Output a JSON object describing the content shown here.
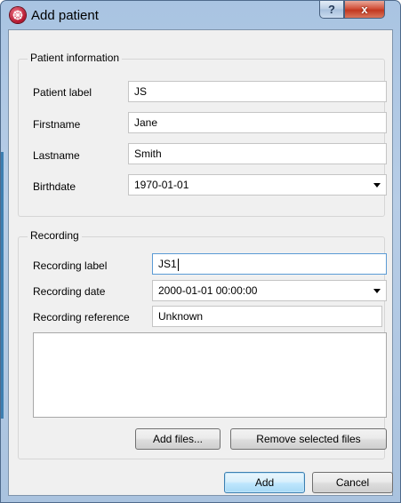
{
  "window": {
    "title": "Add patient",
    "help_glyph": "?",
    "close_glyph": "x",
    "app_icon": "app-logo-icon"
  },
  "patient_info": {
    "group_title": "Patient information",
    "label_label": "Patient label",
    "label_value": "JS",
    "firstname_label": "Firstname",
    "firstname_value": "Jane",
    "lastname_label": "Lastname",
    "lastname_value": "Smith",
    "birthdate_label": "Birthdate",
    "birthdate_value": "1970-01-01"
  },
  "recording": {
    "group_title": "Recording",
    "label_label": "Recording label",
    "label_value": "JS1",
    "date_label": "Recording date",
    "date_value": "2000-01-01 00:00:00",
    "reference_label": "Recording reference",
    "reference_value": "Unknown",
    "files": [],
    "add_files_label": "Add files...",
    "remove_files_label": "Remove selected files"
  },
  "footer": {
    "add_label": "Add",
    "cancel_label": "Cancel"
  },
  "colors": {
    "title_bar": "#b7cde6",
    "close_button": "#c23820",
    "focus_border": "#5b9bd5",
    "default_button": "#bee6fd"
  }
}
